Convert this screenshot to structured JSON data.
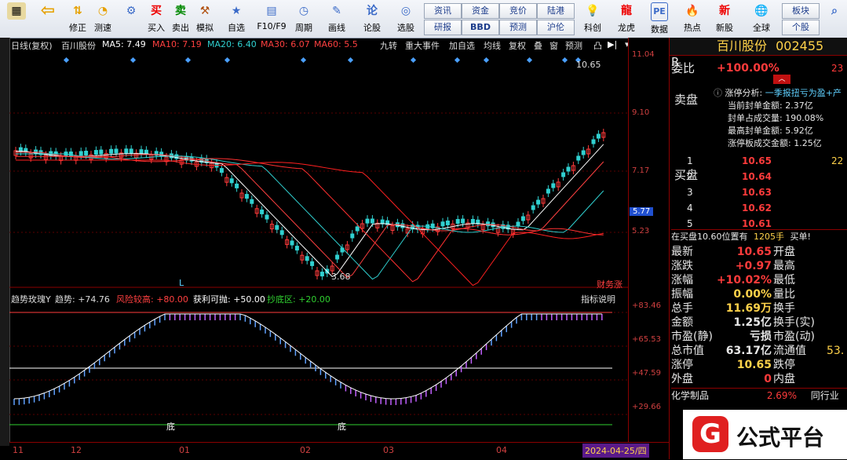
{
  "toolbar": {
    "buttons": [
      {
        "label": "",
        "icon": "back-icon"
      },
      {
        "label": "修正",
        "icon": "up-down-icon"
      },
      {
        "label": "测速",
        "icon": "speedometer-icon"
      },
      {
        "label": "买入",
        "icon": "buy-icon",
        "glyph": "买"
      },
      {
        "label": "卖出",
        "icon": "sell-icon",
        "glyph": "卖"
      },
      {
        "label": "模拟",
        "icon": "hammer-icon"
      },
      {
        "label": "自选",
        "icon": "star-folder-icon"
      },
      {
        "label": "F10/F9",
        "icon": "f10-icon"
      },
      {
        "label": "周期",
        "icon": "clock-icon"
      },
      {
        "label": "画线",
        "icon": "pencil-icon"
      },
      {
        "label": "论股",
        "icon": "comment-icon"
      },
      {
        "label": "选股",
        "icon": "radar-icon"
      }
    ],
    "grid_buttons": [
      "资讯",
      "资金",
      "竞价",
      "陆港",
      "研报",
      "BBD",
      "预测",
      "沪伦"
    ],
    "right_buttons": [
      {
        "label": "科创",
        "icon": "bulb-icon"
      },
      {
        "label": "龙虎",
        "icon": "dragon-icon"
      },
      {
        "label": "数据",
        "icon": "pe-icon",
        "glyph": "PE"
      },
      {
        "label": "热点",
        "icon": "fire-icon"
      },
      {
        "label": "新股",
        "icon": "ipo-icon"
      },
      {
        "label": "全球",
        "icon": "globe-icon"
      }
    ],
    "extra_grid": [
      "板块",
      "个股"
    ]
  },
  "chart_header": {
    "title": "日线(复权)",
    "stock": "百川股份",
    "ma5": "MA5: 7.49",
    "ma10": "MA10: 7.19",
    "ma20": "MA20: 6.40",
    "ma30": "MA30: 6.07",
    "ma60": "MA60: 5.5",
    "tabs": [
      "九转",
      "重大事件",
      "加自选",
      "均线",
      "复权",
      "叠",
      "窗",
      "预测"
    ]
  },
  "chart_annotations": {
    "high": "10.65",
    "low": "3.68",
    "l_mark": "L",
    "tag": "财务涨"
  },
  "indicator_header": {
    "name": "趋势玫瑰Y",
    "trend": "趋势: +74.76",
    "risk": "风险较高: +80.00",
    "profit": "获利可抛: +50.00",
    "bottom": "抄底区: +20.00",
    "btn": "指标说明",
    "bottom_marks": [
      "底",
      "底"
    ]
  },
  "price_axis": [
    "11.04",
    "9.10",
    "7.17",
    "5.77",
    "5.23"
  ],
  "ind_axis": [
    "+83.46",
    "+65.53",
    "+47.59",
    "+29.66"
  ],
  "time_axis": [
    "11",
    "12",
    "01",
    "02",
    "03",
    "04",
    "2024-04-25/四"
  ],
  "side": {
    "name": "百川股份",
    "code": "002455",
    "r": "R",
    "webi_label": "委比",
    "webi": "+100.00%",
    "webi_vol": "23",
    "limit_title": "涨停分析:",
    "limit_reason": "一季报扭亏为盈+产",
    "limit_stats": [
      "当前封单金额: 2.37亿",
      "封单占成交量: 190.08%",
      "最高封单金额: 5.92亿",
      "涨停板成交金额: 1.25亿"
    ],
    "sell_label": "卖盘",
    "buy_label": "买盘",
    "buy_book": [
      {
        "lvl": "1",
        "price": "10.65",
        "vol": "22"
      },
      {
        "lvl": "2",
        "price": "10.64",
        "vol": ""
      },
      {
        "lvl": "3",
        "price": "10.63",
        "vol": ""
      },
      {
        "lvl": "4",
        "price": "10.62",
        "vol": ""
      },
      {
        "lvl": "5",
        "price": "10.61",
        "vol": ""
      }
    ],
    "book_note": "在买盘10.60位置有",
    "book_note_vol": "1205手",
    "book_note_tag": "买单!",
    "quotes": [
      [
        "最新",
        "10.65",
        "开盘",
        ""
      ],
      [
        "涨跌",
        "+0.97",
        "最高",
        ""
      ],
      [
        "涨幅",
        "+10.02%",
        "最低",
        ""
      ],
      [
        "振幅",
        "0.00%",
        "量比",
        ""
      ],
      [
        "总手",
        "11.69万",
        "换手",
        ""
      ],
      [
        "金额",
        "1.25亿",
        "换手(实)",
        ""
      ],
      [
        "市盈(静)",
        "亏损",
        "市盈(动)",
        ""
      ],
      [
        "总市值",
        "63.17亿",
        "流通值",
        "53."
      ],
      [
        "涨停",
        "10.65",
        "跌停",
        ""
      ],
      [
        "外盘",
        "0",
        "内盘",
        ""
      ]
    ],
    "sector": "化学制品",
    "sector_pct": "2.69%",
    "sector_tag": "同行业"
  },
  "logo": {
    "text": "公式平台"
  },
  "colors": {
    "up": "#ff3b3b",
    "down": "#30d0d0",
    "bg": "#000000",
    "grid": "#8b0000"
  }
}
